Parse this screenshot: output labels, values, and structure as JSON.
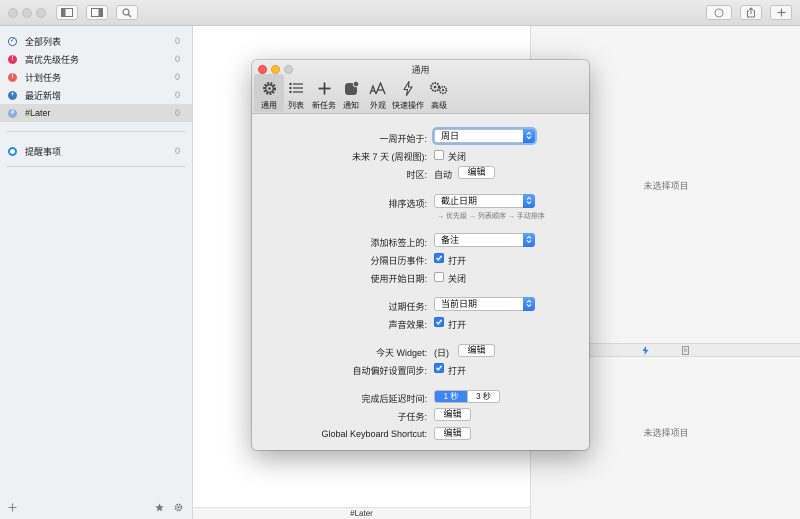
{
  "sidebar": {
    "items": [
      {
        "label": "全部列表",
        "count": "0",
        "color": "#2d6ec9",
        "glyph": "✓"
      },
      {
        "label": "高优先级任务",
        "count": "0",
        "color": "#e0365f",
        "glyph": "!"
      },
      {
        "label": "计划任务",
        "count": "0",
        "color": "#e56457",
        "glyph": "!"
      },
      {
        "label": "最近新增",
        "count": "0",
        "color": "#3b79c6",
        "glyph": "+"
      },
      {
        "label": "#Later",
        "count": "0",
        "color": "#8aaed8",
        "glyph": "#"
      }
    ],
    "reminders": {
      "label": "提醒事项",
      "count": "0",
      "color": "#1a8fe8"
    }
  },
  "list": {
    "footer_title": "#Later"
  },
  "detail": {
    "empty_top": "未选择项目",
    "empty_bottom": "未选择项目"
  },
  "prefs": {
    "title": "通用",
    "tabs": [
      {
        "label": "通用",
        "icon": "gear-icon"
      },
      {
        "label": "列表",
        "icon": "list-icon"
      },
      {
        "label": "新任务",
        "icon": "plus-icon"
      },
      {
        "label": "通知",
        "icon": "notification-icon"
      },
      {
        "label": "外观",
        "icon": "font-size-icon"
      },
      {
        "label": "快速操作",
        "icon": "bolt-icon"
      },
      {
        "label": "高级",
        "icon": "gears-icon"
      }
    ],
    "week_start": {
      "label": "一周开始于:",
      "value": "周日"
    },
    "next7": {
      "label": "未来 7 天 (周视图):",
      "checkbox": "关闭"
    },
    "timezone": {
      "label": "时区:",
      "value": "自动",
      "button": "编辑"
    },
    "sort": {
      "label": "排序选项:",
      "value": "截止日期",
      "hint": "→ 优先级 → 列表顺序 → 手动排序"
    },
    "tag_add": {
      "label": "添加标签上的:",
      "value": "备注"
    },
    "split_calendar": {
      "label": "分隔日历事件:",
      "checkbox": "打开"
    },
    "use_start_date": {
      "label": "使用开始日期:",
      "checkbox": "关闭"
    },
    "overdue": {
      "label": "过期任务:",
      "value": "当前日期"
    },
    "sound": {
      "label": "声音效果:",
      "checkbox": "打开"
    },
    "widget": {
      "label": "今天 Widget:",
      "value": "(日)",
      "button": "编辑"
    },
    "sync": {
      "label": "自动偏好设置同步:",
      "checkbox": "打开"
    },
    "delay": {
      "label": "完成后延迟时间:",
      "seg_a": "1 秒",
      "seg_b": "3 秒"
    },
    "subtasks": {
      "label": "子任务:",
      "button": "编辑"
    },
    "shortcut": {
      "label": "Global Keyboard Shortcut:",
      "button": "编辑"
    }
  }
}
